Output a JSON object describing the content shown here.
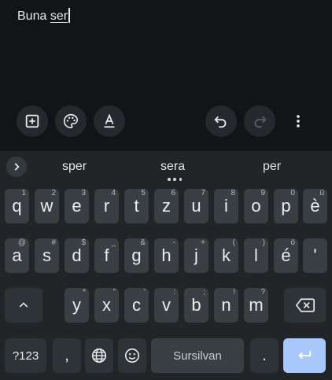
{
  "editor": {
    "text_plain": "Buna ",
    "text_composing": "ser"
  },
  "toolbar": {
    "icons": [
      "add-box-icon",
      "palette-icon",
      "text-format-icon",
      "undo-icon",
      "redo-icon",
      "more-vert-icon"
    ]
  },
  "suggestions": {
    "items": [
      "sper",
      "sera",
      "per"
    ]
  },
  "keys": {
    "row1": [
      {
        "label": "q",
        "hint": "1"
      },
      {
        "label": "w",
        "hint": "2"
      },
      {
        "label": "e",
        "hint": "3"
      },
      {
        "label": "r",
        "hint": "4"
      },
      {
        "label": "t",
        "hint": "5"
      },
      {
        "label": "z",
        "hint": "6"
      },
      {
        "label": "u",
        "hint": "7"
      },
      {
        "label": "i",
        "hint": "8"
      },
      {
        "label": "o",
        "hint": "9"
      },
      {
        "label": "p",
        "hint": "0"
      },
      {
        "label": "è",
        "hint": "ü"
      }
    ],
    "row2": [
      {
        "label": "a",
        "hint": "@"
      },
      {
        "label": "s",
        "hint": "#"
      },
      {
        "label": "d",
        "hint": "$"
      },
      {
        "label": "f",
        "hint": "_"
      },
      {
        "label": "g",
        "hint": "&"
      },
      {
        "label": "h",
        "hint": "-"
      },
      {
        "label": "j",
        "hint": "+"
      },
      {
        "label": "k",
        "hint": "("
      },
      {
        "label": "l",
        "hint": ")"
      },
      {
        "label": "é",
        "hint": "ö"
      },
      {
        "label": "'",
        "hint": ""
      }
    ],
    "row3": [
      {
        "label": "y",
        "hint": "*"
      },
      {
        "label": "x",
        "hint": "\""
      },
      {
        "label": "c",
        "hint": "'"
      },
      {
        "label": "v",
        "hint": ":"
      },
      {
        "label": "b",
        "hint": ";"
      },
      {
        "label": "n",
        "hint": "!"
      },
      {
        "label": "m",
        "hint": "?"
      }
    ],
    "symbols_label": "?123",
    "comma_label": ",",
    "period_label": ".",
    "space_label": "Sursilvan"
  }
}
